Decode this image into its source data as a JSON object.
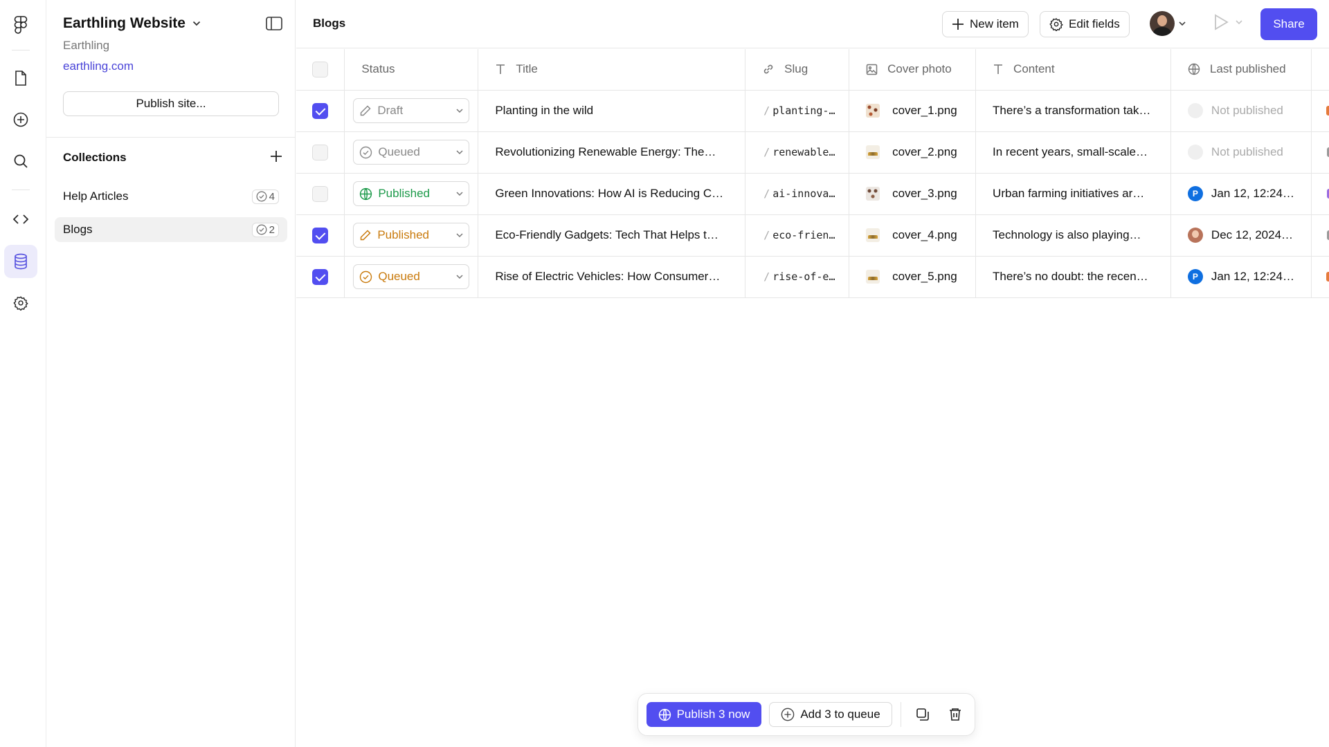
{
  "project": {
    "title": "Earthling Website",
    "subtitle": "Earthling",
    "domain": "earthling.com",
    "publish_label": "Publish site..."
  },
  "collections": {
    "title": "Collections",
    "items": [
      {
        "label": "Help Articles",
        "count": "4"
      },
      {
        "label": "Blogs",
        "count": "2"
      }
    ]
  },
  "header": {
    "breadcrumb": "Blogs",
    "new_item_label": "New item",
    "edit_fields_label": "Edit fields",
    "share_label": "Share"
  },
  "table": {
    "columns": [
      "Status",
      "Title",
      "Slug",
      "Cover photo",
      "Content",
      "Last published"
    ],
    "rows": [
      {
        "checked": true,
        "status": "Draft",
        "title": "Planting in the wild",
        "slug": "planting-…",
        "cover": "cover_1.png",
        "content": "There’s a transformation tak…",
        "last_published": "Not published"
      },
      {
        "checked": false,
        "status": "Queued",
        "title": "Revolutionizing Renewable Energy: The…",
        "slug": "renewable…",
        "cover": "cover_2.png",
        "content": "In recent years, small-scale…",
        "last_published": "Not published"
      },
      {
        "checked": false,
        "status": "Published",
        "title": "Green Innovations: How AI is Reducing C…",
        "slug": "ai-innova…",
        "cover": "cover_3.png",
        "content": "Urban farming initiatives ar…",
        "last_published": "Jan 12, 12:24…"
      },
      {
        "checked": true,
        "status": "Published",
        "title": "Eco-Friendly Gadgets: Tech That Helps t…",
        "slug": "eco-frien…",
        "cover": "cover_4.png",
        "content": "Technology is also playing…",
        "last_published": "Dec 12, 2024…"
      },
      {
        "checked": true,
        "status": "Queued",
        "title": "Rise of Electric Vehicles: How Consumer…",
        "slug": "rise-of-e…",
        "cover": "cover_5.png",
        "content": "There’s no doubt: the recen…",
        "last_published": "Jan 12, 12:24…"
      }
    ]
  },
  "action_bar": {
    "publish_label": "Publish 3 now",
    "queue_label": "Add 3 to queue"
  },
  "colors": {
    "accent": "#524ef0",
    "published_green": "#1d9a4a",
    "warning_orange": "#c97a0c",
    "avatar_blue": "#0f6fe0"
  }
}
